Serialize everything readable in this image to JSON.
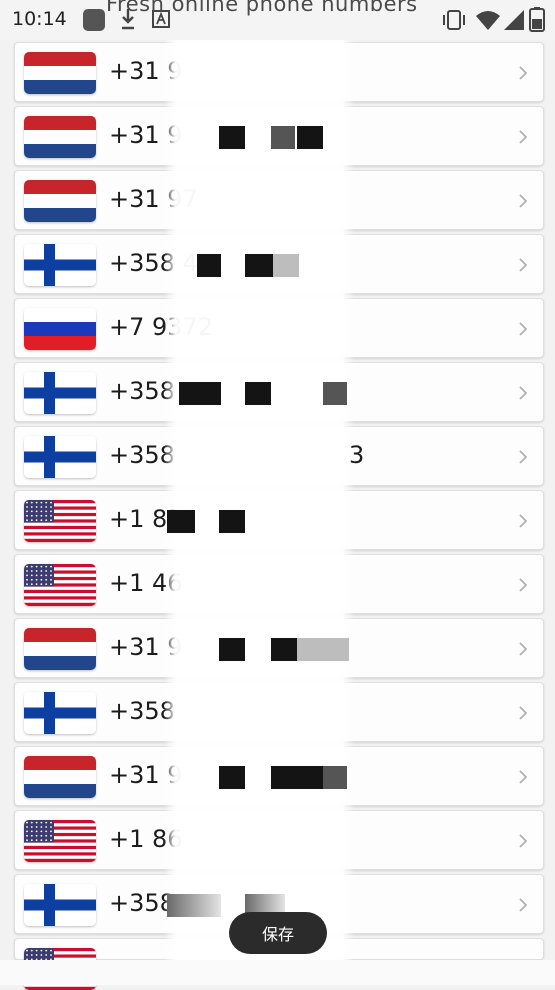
{
  "status_bar": {
    "time": "10:14",
    "left_icons": [
      "app-square-icon",
      "download-icon",
      "a-icon"
    ],
    "right_icons": [
      "vibrate-icon",
      "wifi-icon",
      "signal-icon",
      "battery-icon"
    ]
  },
  "page": {
    "title": "Fresh online phone numbers"
  },
  "numbers": [
    {
      "country": "nl",
      "number": "+31 9"
    },
    {
      "country": "nl",
      "number": "+31 9"
    },
    {
      "country": "nl",
      "number": "+31 97"
    },
    {
      "country": "fi",
      "number": "+358 4"
    },
    {
      "country": "ru",
      "number": "+7 9372"
    },
    {
      "country": "fi",
      "number": "+358 4"
    },
    {
      "country": "fi",
      "number": "+358"
    },
    {
      "country": "us",
      "number": "+1 83"
    },
    {
      "country": "us",
      "number": "+1 46"
    },
    {
      "country": "nl",
      "number": "+31 9"
    },
    {
      "country": "fi",
      "number": "+358"
    },
    {
      "country": "nl",
      "number": "+31 9"
    },
    {
      "country": "us",
      "number": "+1 86"
    },
    {
      "country": "fi",
      "number": "+358"
    },
    {
      "country": "us",
      "number": ""
    }
  ],
  "row7_tail": "3",
  "toast": {
    "label": "保存"
  },
  "colors": {
    "nl_red": "#c8242c",
    "nl_blue": "#21468b",
    "fi_blue": "#0c3fa0",
    "ru_blue": "#1c39bb",
    "ru_red": "#e31d25",
    "us_red": "#c8102e",
    "us_blue": "#3c3b6e"
  }
}
